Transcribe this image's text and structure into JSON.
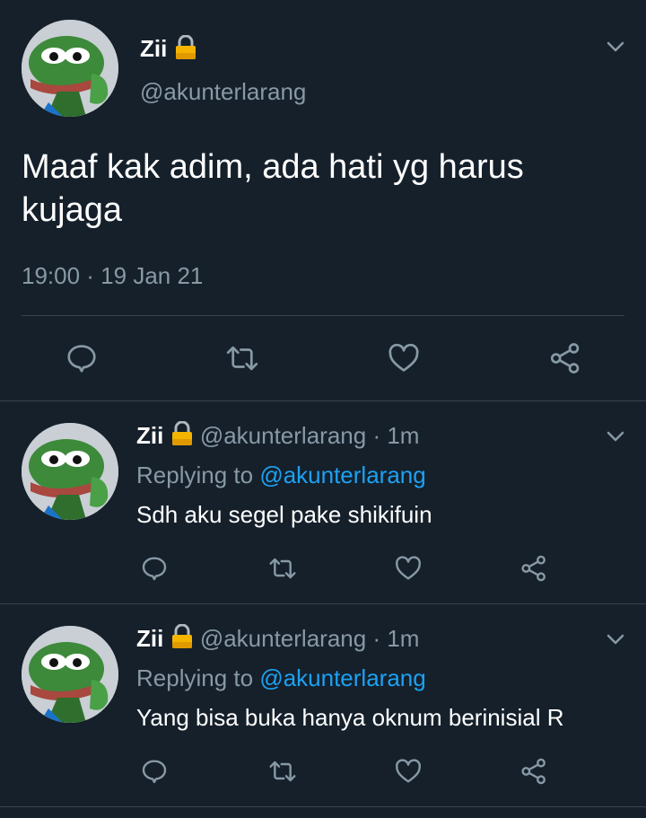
{
  "colors": {
    "background": "#15202b",
    "text": "#ffffff",
    "muted": "#8899a6",
    "link": "#1da1f2",
    "divider": "#38444d",
    "lock": "#f4b400"
  },
  "main_tweet": {
    "display_name": "Zii",
    "handle": "@akunterlarang",
    "text": "Maaf kak adim, ada hati yg harus kujaga",
    "timestamp": "19:00 · 19 Jan 21",
    "actions": [
      "reply-icon",
      "retweet-icon",
      "like-icon",
      "share-icon"
    ]
  },
  "replies": [
    {
      "display_name": "Zii",
      "handle": "@akunterlarang",
      "time": "· 1m",
      "replying_prefix": "Replying to",
      "replying_to": "@akunterlarang",
      "text": "Sdh aku segel pake shikifuin"
    },
    {
      "display_name": "Zii",
      "handle": "@akunterlarang",
      "time": "· 1m",
      "replying_prefix": "Replying to",
      "replying_to": "@akunterlarang",
      "text": "Yang bisa buka hanya oknum berinisial R"
    }
  ]
}
